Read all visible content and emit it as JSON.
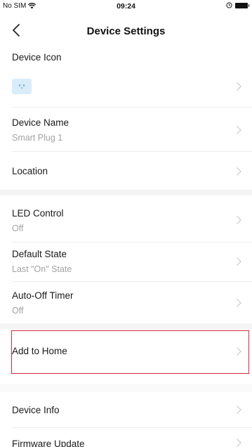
{
  "status_bar": {
    "carrier": "No SIM",
    "time": "09:24"
  },
  "nav": {
    "title": "Device Settings"
  },
  "settings": {
    "device_icon_label": "Device Icon",
    "device_name_label": "Device Name",
    "device_name_value": "Smart Plug 1",
    "location_label": "Location",
    "led_control_label": "LED Control",
    "led_control_value": "Off",
    "default_state_label": "Default State",
    "default_state_value": "Last \"On\" State",
    "auto_off_label": "Auto-Off Timer",
    "auto_off_value": "Off",
    "add_to_home_label": "Add to Home",
    "device_info_label": "Device Info",
    "firmware_update_label": "Firmware Update"
  },
  "colors": {
    "highlight": "#d32a3a",
    "device_icon_bg": "#d9ecfa",
    "section_gap": "#f4f4f4"
  }
}
